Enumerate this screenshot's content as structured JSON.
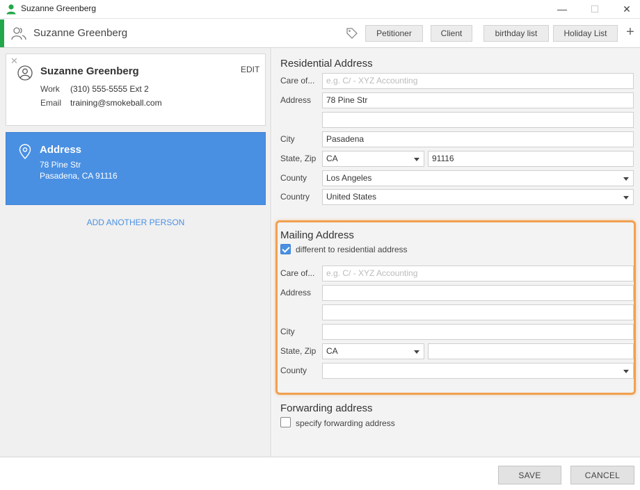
{
  "window": {
    "title": "Suzanne Greenberg",
    "minimize": "—",
    "maximize": "☐",
    "close": "✕"
  },
  "header": {
    "name": "Suzanne Greenberg",
    "tags": [
      "Petitioner",
      "Client",
      "birthday list",
      "Holiday List"
    ],
    "add": "+"
  },
  "contact": {
    "remove": "✕",
    "name": "Suzanne Greenberg",
    "edit": "EDIT",
    "work_label": "Work",
    "work_value": "(310) 555-5555 Ext 2",
    "email_label": "Email",
    "email_value": "training@smokeball.com"
  },
  "address_card": {
    "title": "Address",
    "line1": "78 Pine Str",
    "line2": "Pasadena, CA 91116"
  },
  "add_person": "ADD ANOTHER PERSON",
  "residential": {
    "title": "Residential Address",
    "care_of_label": "Care of...",
    "care_of_placeholder": "e.g. C/ - XYZ Accounting",
    "address_label": "Address",
    "address1": "78 Pine Str",
    "address2": "",
    "city_label": "City",
    "city": "Pasadena",
    "state_zip_label": "State, Zip",
    "state": "CA",
    "zip": "91116",
    "county_label": "County",
    "county": "Los Angeles",
    "country_label": "Country",
    "country": "United States"
  },
  "mailing": {
    "title": "Mailing Address",
    "different_label": "different to residential address",
    "different_checked": true,
    "care_of_label": "Care of...",
    "care_of_placeholder": "e.g. C/ - XYZ Accounting",
    "address_label": "Address",
    "address1": "",
    "address2": "",
    "city_label": "City",
    "city": "",
    "state_zip_label": "State, Zip",
    "state": "CA",
    "zip": "",
    "county_label": "County",
    "county": ""
  },
  "forwarding": {
    "title": "Forwarding address",
    "specify_label": "specify forwarding address",
    "specify_checked": false
  },
  "footer": {
    "save": "SAVE",
    "cancel": "CANCEL"
  },
  "colors": {
    "accent_green": "#22a84a",
    "selected_blue": "#4a90e2",
    "highlight_orange": "#f0a050"
  }
}
